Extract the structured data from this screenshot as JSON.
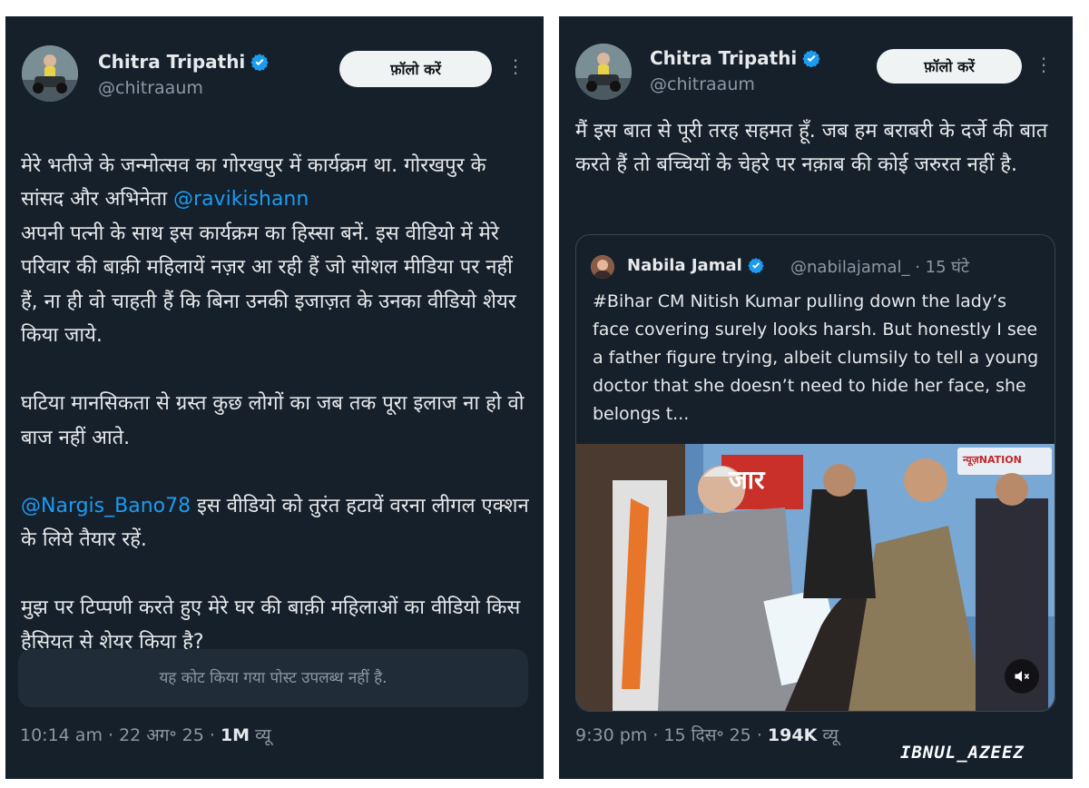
{
  "left_tweet": {
    "author": {
      "name": "Chitra Tripathi",
      "handle": "@chitraaum",
      "verified": true
    },
    "follow_label": "फ़ॉलो करें",
    "text_parts": {
      "p1_before": "मेरे भतीजे के जन्मोत्सव का गोरखपुर में कार्यक्रम था. गोरखपुर के सांसद और अभिनेता ",
      "p1_mention": "@ravikishann",
      "p1_after": "\nअपनी पत्नी के साथ इस कार्यक्रम का हिस्सा बनें. इस वीडियो में मेरे परिवार की बाक़ी महिलायें नज़र आ रही हैं जो सोशल मीडिया पर नहीं हैं, ना ही वो चाहती हैं कि बिना उनकी इजाज़त के उनका वीडियो शेयर किया जाये.",
      "p2": "घटिया मानसिकता से ग्रस्त कुछ लोगों का जब तक पूरा इलाज ना हो वो बाज नहीं आते.",
      "p3_mention": "@Nargis_Bano78",
      "p3_after": " इस वीडियो को तुरंत हटायें वरना लीगल एक्शन के लिये तैयार रहें.",
      "p4": "मुझ पर टिप्पणी करते हुए मेरे घर की बाक़ी महिलाओं का वीडियो किस हैसियत से शेयर किया है?"
    },
    "quote_unavailable": "यह कोट किया गया पोस्ट उपलब्ध नहीं है.",
    "meta": {
      "time_date": "10:14 am · 22 अग॰ 25 · ",
      "views_count": "1M",
      "views_label": " व्यू"
    }
  },
  "right_tweet": {
    "author": {
      "name": "Chitra Tripathi",
      "handle": "@chitraaum",
      "verified": true
    },
    "follow_label": "फ़ॉलो करें",
    "text": "मैं इस बात से पूरी तरह सहमत हूँ. जब हम बराबरी के दर्जे की बात करते हैं तो बच्चियों के चेहरे पर नक़ाब की कोई जरुरत नहीं है.",
    "quoted": {
      "name": "Nabila Jamal",
      "verified": true,
      "handle_time": "@nabilajamal_ · 15 घंटे",
      "text": "#Bihar CM Nitish Kumar pulling down the lady’s face covering surely looks harsh. But honestly I see a father figure trying, albeit clumsily to tell a young doctor that she doesn’t need to hide her face, she belongs t...",
      "media_channel_logo": "न्यूज़NATION",
      "media_banner_text": "जार",
      "media_icon": "mute-icon"
    },
    "meta": {
      "time_date": "9:30 pm · 15 दिस॰ 25 · ",
      "views_count": "194K",
      "views_label": " व्यू"
    }
  },
  "watermark": "IBNUL_AZEEZ",
  "colors": {
    "background": "#15202b",
    "text": "#e7e9ea",
    "secondary": "#8b98a5",
    "link": "#1d9bf0",
    "verified": "#1d9bf0"
  }
}
